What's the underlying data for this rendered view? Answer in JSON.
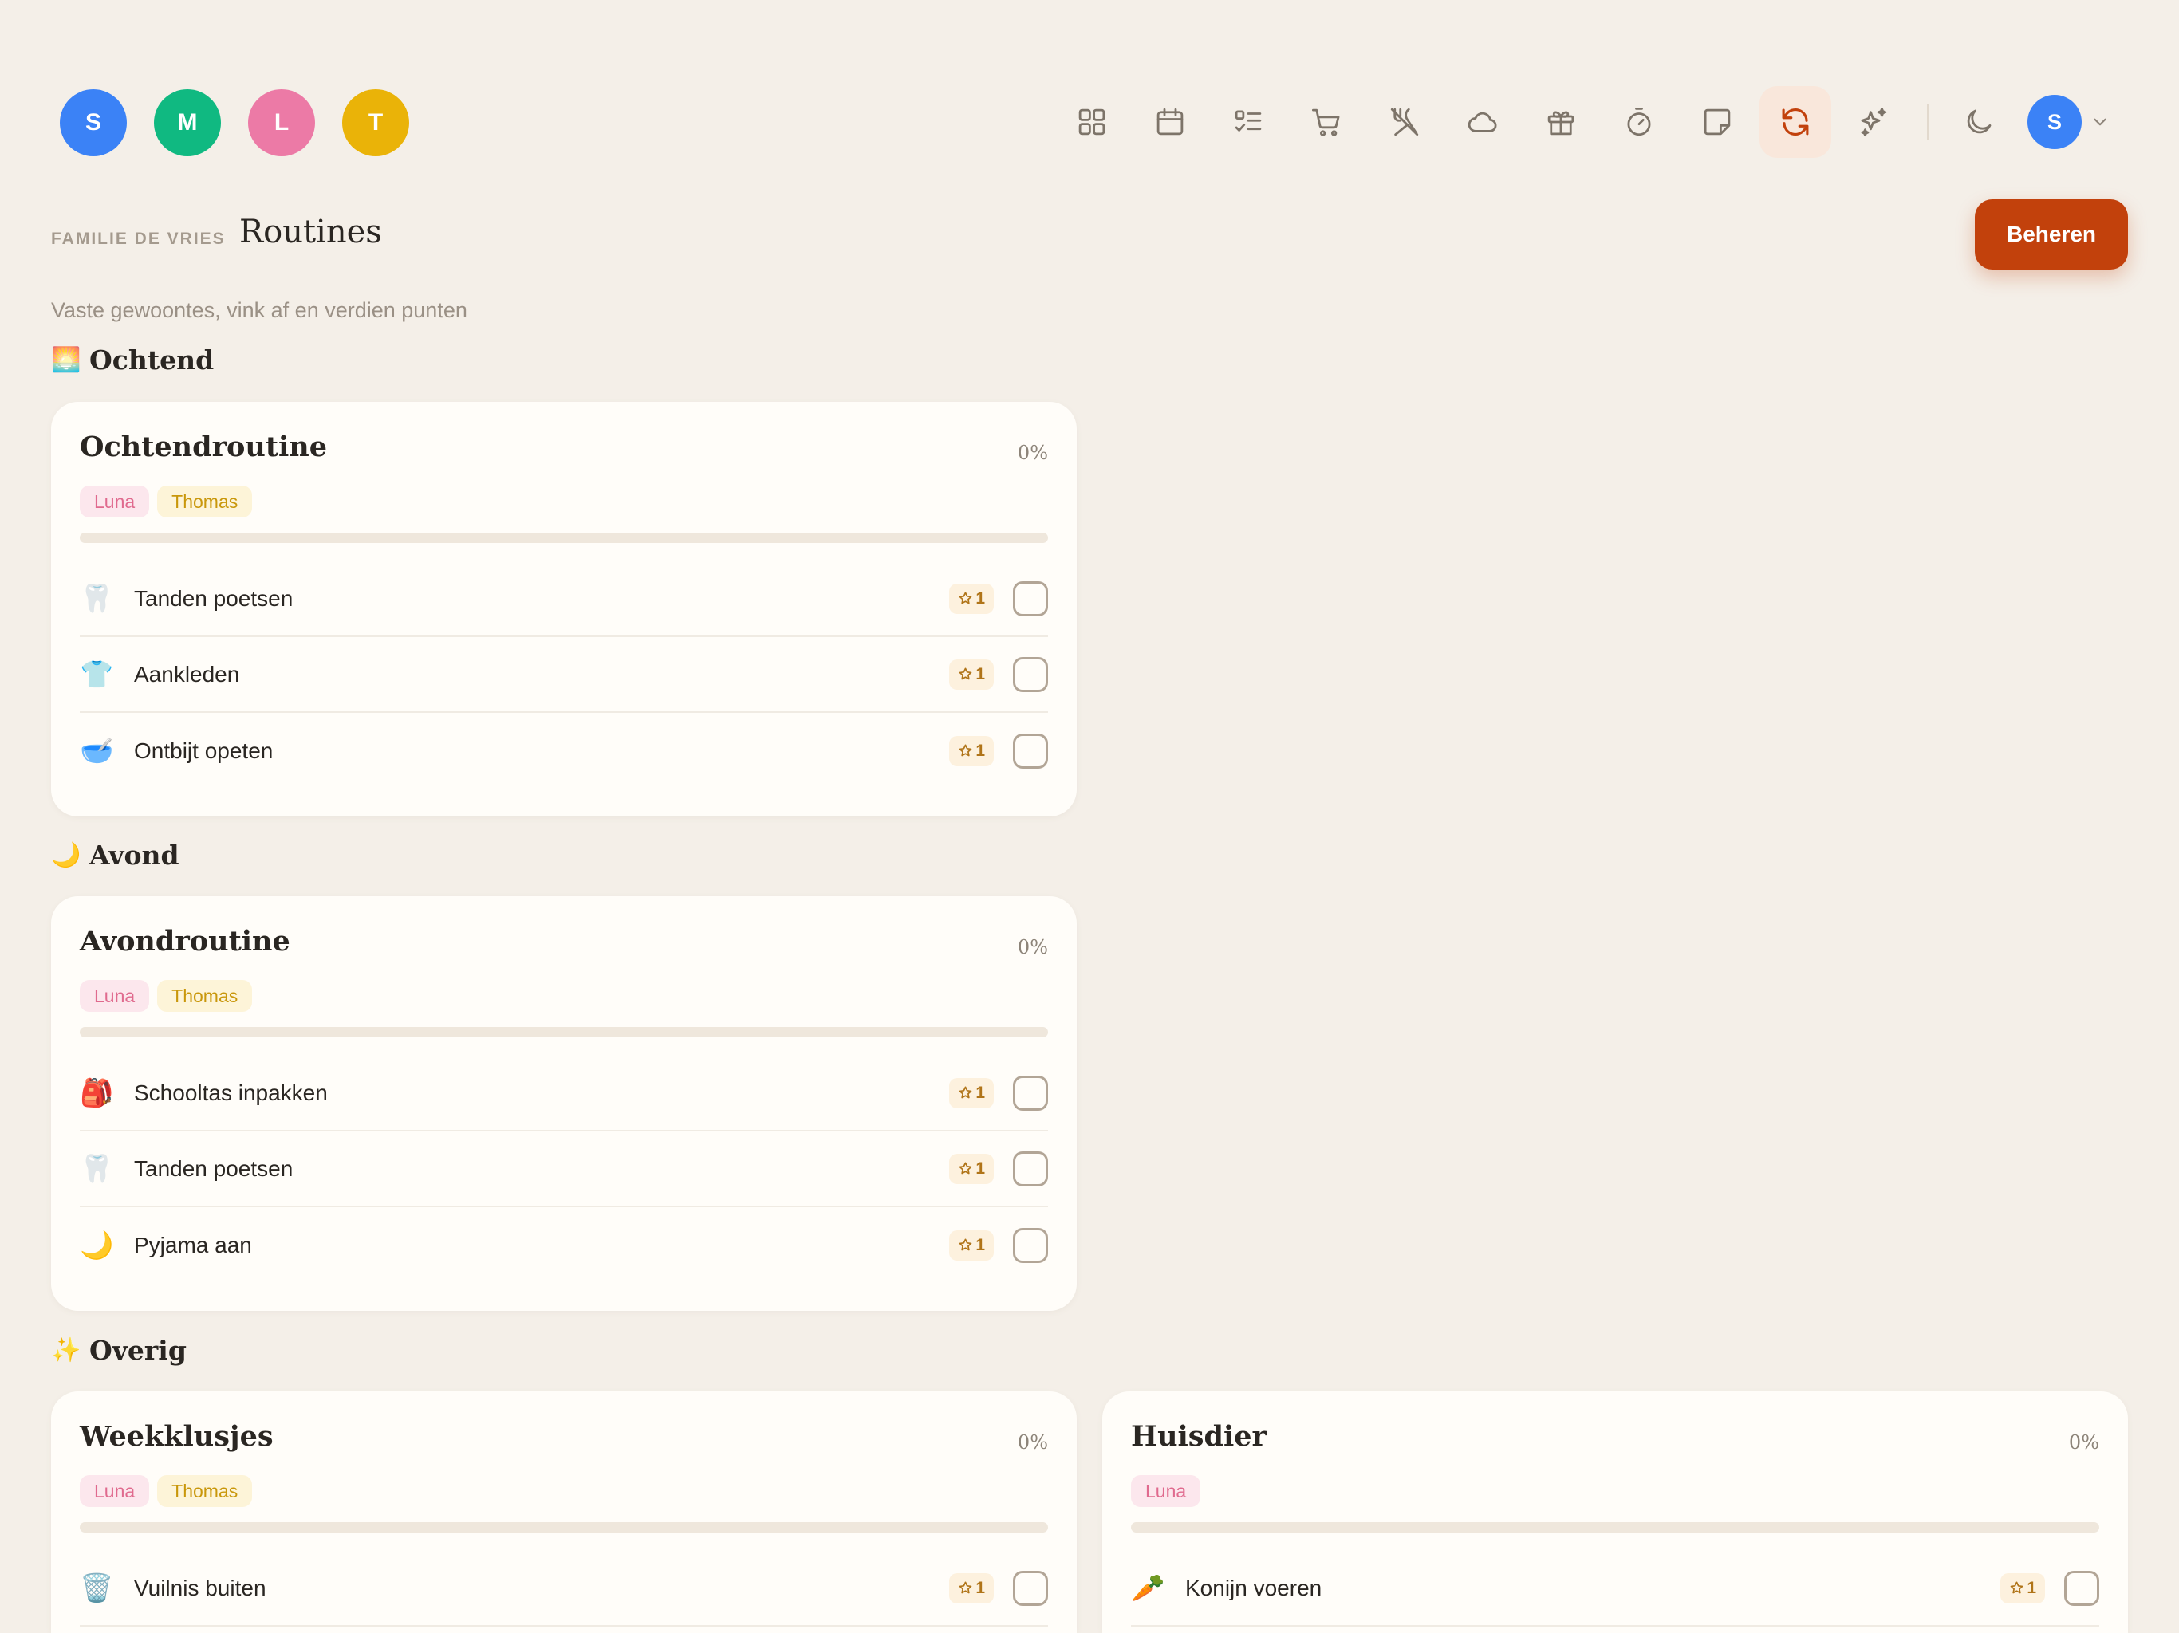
{
  "members": [
    {
      "initial": "S",
      "color": "#3b82f6"
    },
    {
      "initial": "M",
      "color": "#10b981"
    },
    {
      "initial": "L",
      "color": "#ec7aa6"
    },
    {
      "initial": "T",
      "color": "#eab308"
    }
  ],
  "nav": {
    "items": [
      {
        "icon": "grid-icon",
        "active": false
      },
      {
        "icon": "calendar-icon",
        "active": false
      },
      {
        "icon": "checklist-icon",
        "active": false
      },
      {
        "icon": "cart-icon",
        "active": false
      },
      {
        "icon": "utensils-off-icon",
        "active": false
      },
      {
        "icon": "cloud-icon",
        "active": false
      },
      {
        "icon": "gift-icon",
        "active": false
      },
      {
        "icon": "timer-icon",
        "active": false
      },
      {
        "icon": "note-icon",
        "active": false
      },
      {
        "icon": "refresh-icon",
        "active": true
      },
      {
        "icon": "sparkles-icon",
        "active": false
      }
    ],
    "theme_icon": "moon-icon",
    "profile_initial": "S"
  },
  "header": {
    "crumb": "FAMILIE DE VRIES",
    "title": "Routines",
    "manage_label": "Beheren",
    "subtitle": "Vaste gewoontes, vink af en verdien punten"
  },
  "colors": {
    "accent": "#c2410c",
    "background": "#f4efe8",
    "card": "#fffdf9"
  },
  "sections": {
    "morning": {
      "emoji": "🌅",
      "label": "Ochtend"
    },
    "evening": {
      "emoji": "🌙",
      "label": "Avond"
    },
    "other": {
      "emoji": "✨",
      "label": "Overig"
    }
  },
  "routines": {
    "ochtend": {
      "title": "Ochtendroutine",
      "percent": "0%",
      "progress": 0,
      "tags": [
        "Luna",
        "Thomas"
      ],
      "items": [
        {
          "emoji": "🦷",
          "name": "Tanden poetsen",
          "points": "1",
          "checked": false
        },
        {
          "emoji": "👕",
          "name": "Aankleden",
          "points": "1",
          "checked": false
        },
        {
          "emoji": "🥣",
          "name": "Ontbijt opeten",
          "points": "1",
          "checked": false
        }
      ]
    },
    "avond": {
      "title": "Avondroutine",
      "percent": "0%",
      "progress": 0,
      "tags": [
        "Luna",
        "Thomas"
      ],
      "items": [
        {
          "emoji": "🎒",
          "name": "Schooltas inpakken",
          "points": "1",
          "checked": false
        },
        {
          "emoji": "🦷",
          "name": "Tanden poetsen",
          "points": "1",
          "checked": false
        },
        {
          "emoji": "🌙",
          "name": "Pyjama aan",
          "points": "1",
          "checked": false
        }
      ]
    },
    "week": {
      "title": "Weekklusjes",
      "percent": "0%",
      "progress": 0,
      "tags": [
        "Luna",
        "Thomas"
      ],
      "items": [
        {
          "emoji": "🗑️",
          "name": "Vuilnis buiten",
          "points": "1",
          "checked": false
        }
      ]
    },
    "huisdier": {
      "title": "Huisdier",
      "percent": "0%",
      "progress": 0,
      "tags": [
        "Luna"
      ],
      "items": [
        {
          "emoji": "🥕",
          "name": "Konijn voeren",
          "points": "1",
          "checked": false
        }
      ]
    }
  }
}
